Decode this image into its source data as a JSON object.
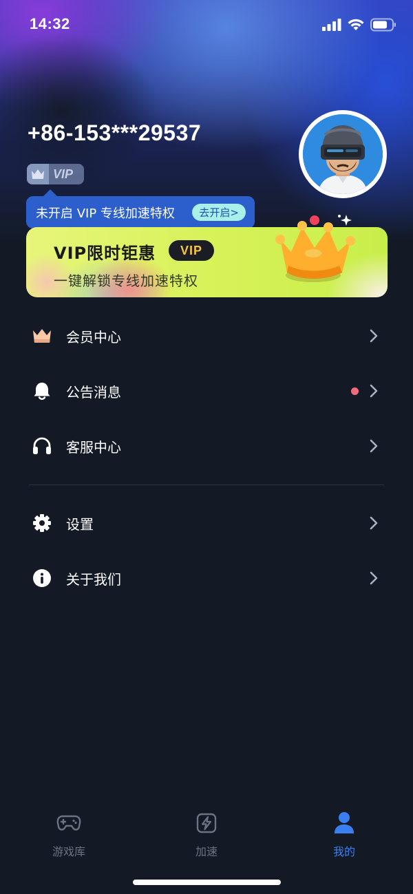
{
  "status_bar": {
    "time": "14:32"
  },
  "profile": {
    "phone": "+86-153***29537",
    "vip_tag": "VIP",
    "tooltip_text": "未开启 VIP 专线加速特权",
    "tooltip_button": "去开启>"
  },
  "promo": {
    "title": "VIP限时钜惠",
    "badge": "VIP",
    "subtitle": "一键解锁专线加速特权"
  },
  "menu": {
    "items": [
      {
        "label": "会员中心",
        "icon": "crown-icon"
      },
      {
        "label": "公告消息",
        "icon": "bell-icon",
        "has_dot": true
      },
      {
        "label": "客服中心",
        "icon": "headphones-icon"
      },
      {
        "label": "设置",
        "icon": "gear-icon"
      },
      {
        "label": "关于我们",
        "icon": "info-icon"
      }
    ]
  },
  "tabbar": {
    "tabs": [
      {
        "label": "游戏库",
        "icon": "gamepad-icon",
        "active": false
      },
      {
        "label": "加速",
        "icon": "lightning-icon",
        "active": false
      },
      {
        "label": "我的",
        "icon": "user-icon",
        "active": true
      }
    ]
  },
  "colors": {
    "background": "#131a26",
    "accent": "#3a7ff2",
    "tooltip": "#2d5fcc",
    "notification_dot": "#f26a7e",
    "promo_badge_text": "#f7c53a"
  }
}
